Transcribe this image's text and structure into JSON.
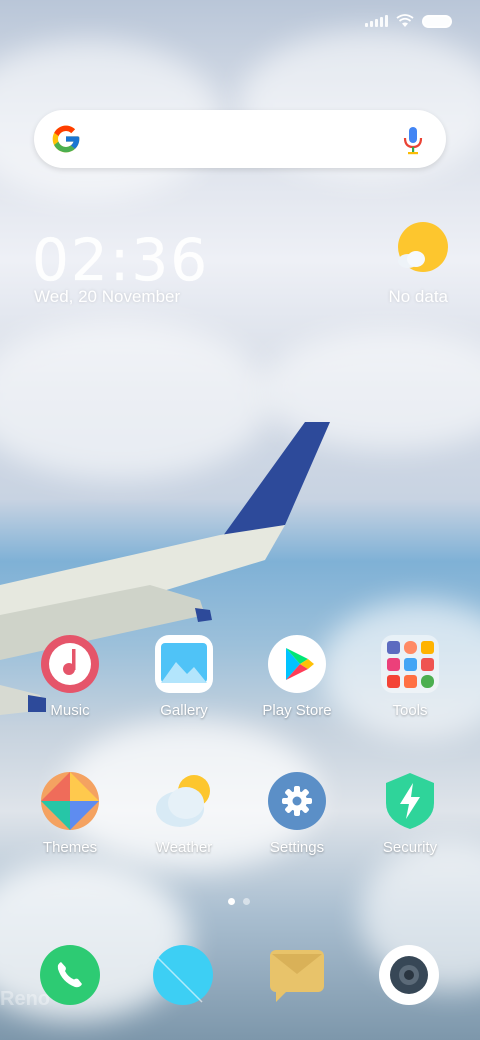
{
  "status_bar": {
    "icons": [
      "signal-icon",
      "wifi-icon",
      "battery-icon"
    ]
  },
  "search": {
    "logo": "google-g-icon",
    "mic": "microphone-icon"
  },
  "clock": {
    "time": "02:36",
    "date": "Wed, 20 November"
  },
  "weather": {
    "icon": "sun-cloud-icon",
    "text": "No data"
  },
  "apps": [
    {
      "label": "Music",
      "icon": "music-icon"
    },
    {
      "label": "Gallery",
      "icon": "gallery-icon"
    },
    {
      "label": "Play Store",
      "icon": "play-store-icon"
    },
    {
      "label": "Tools",
      "icon": "tools-folder-icon"
    },
    {
      "label": "Themes",
      "icon": "themes-icon"
    },
    {
      "label": "Weather",
      "icon": "weather-icon"
    },
    {
      "label": "Settings",
      "icon": "settings-icon"
    },
    {
      "label": "Security",
      "icon": "security-icon"
    }
  ],
  "pages": {
    "count": 2,
    "active": 1
  },
  "dock": [
    {
      "icon": "phone-icon"
    },
    {
      "icon": "browser-icon"
    },
    {
      "icon": "messages-icon"
    },
    {
      "icon": "camera-icon"
    }
  ],
  "watermark": "Reno"
}
